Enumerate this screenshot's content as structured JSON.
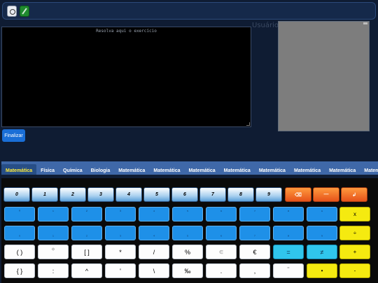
{
  "toolbar": {
    "app_icon": "app-icon",
    "edit_icon": "pencil-icon"
  },
  "workspace": {
    "placeholder": "Resolva aqui o exercício",
    "side_label": "Usuário"
  },
  "finalize_label": "Finalizar",
  "tabs": [
    "Matemática",
    "Física",
    "Química",
    "Biologia",
    "Matemática",
    "Matemática",
    "Matemática",
    "Matemática",
    "Matemática",
    "Matemática",
    "Matemática",
    "Matemática"
  ],
  "keypad": {
    "row1": [
      "0",
      "1",
      "2",
      "3",
      "4",
      "5",
      "6",
      "7",
      "8",
      "9",
      "⌫",
      "—",
      "↲"
    ],
    "row2": [
      "⁰",
      "¹",
      "²",
      "³",
      "⁴",
      "⁵",
      "⁶",
      "⁷",
      "⁸",
      "⁹",
      "x"
    ],
    "row3": [
      "₀",
      "₁",
      "₂",
      "₃",
      "₄",
      "₅",
      "₆",
      "₇",
      "₈",
      "₉",
      "÷"
    ],
    "row4": [
      "( )",
      "⁽⁾",
      "[ ]",
      "*",
      "/",
      "%",
      "∈",
      "€",
      "=",
      "≠",
      "+"
    ],
    "row5": [
      "{ }",
      ":",
      "^",
      "'",
      "\\",
      "‰",
      ".",
      ",",
      "¨",
      "•",
      "-"
    ]
  },
  "colors": {
    "accent": "#1a6ed6",
    "tab_bar": "#3f68a8",
    "active_tab_text": "#ffec3a",
    "yellow_keys": "#f5ea10",
    "orange_keys": "#e6521a"
  }
}
